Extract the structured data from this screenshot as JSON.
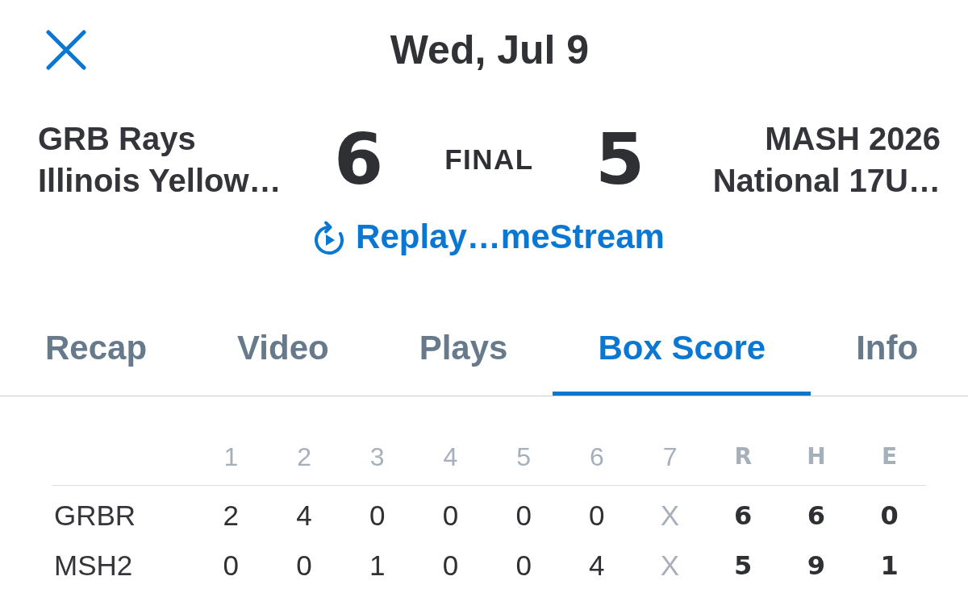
{
  "header": {
    "title": "Wed, Jul 9"
  },
  "matchup": {
    "away": {
      "name_lines": [
        "GRB Rays",
        "Illinois Yellow…"
      ],
      "score": "6"
    },
    "status": "FINAL",
    "home": {
      "name_lines": [
        "MASH 2026",
        "National 17U…"
      ],
      "score": "5"
    }
  },
  "replay_link": {
    "label": "Replay…meStream"
  },
  "tabs": [
    {
      "label": "Recap",
      "selected": false
    },
    {
      "label": "Video",
      "selected": false
    },
    {
      "label": "Plays",
      "selected": false
    },
    {
      "label": "Box Score",
      "selected": true
    },
    {
      "label": "Info",
      "selected": false
    }
  ],
  "box_score": {
    "columns": [
      {
        "label": "1",
        "kind": "inning"
      },
      {
        "label": "2",
        "kind": "inning"
      },
      {
        "label": "3",
        "kind": "inning"
      },
      {
        "label": "4",
        "kind": "inning"
      },
      {
        "label": "5",
        "kind": "inning"
      },
      {
        "label": "6",
        "kind": "inning"
      },
      {
        "label": "7",
        "kind": "unplayed"
      },
      {
        "label": "R",
        "kind": "total"
      },
      {
        "label": "H",
        "kind": "total"
      },
      {
        "label": "E",
        "kind": "total"
      }
    ],
    "rows": [
      {
        "team": "GRBR",
        "cells": [
          "2",
          "4",
          "0",
          "0",
          "0",
          "0",
          "X",
          "6",
          "6",
          "0"
        ]
      },
      {
        "team": "MSH2",
        "cells": [
          "0",
          "0",
          "1",
          "0",
          "0",
          "4",
          "X",
          "5",
          "9",
          "1"
        ]
      }
    ]
  }
}
